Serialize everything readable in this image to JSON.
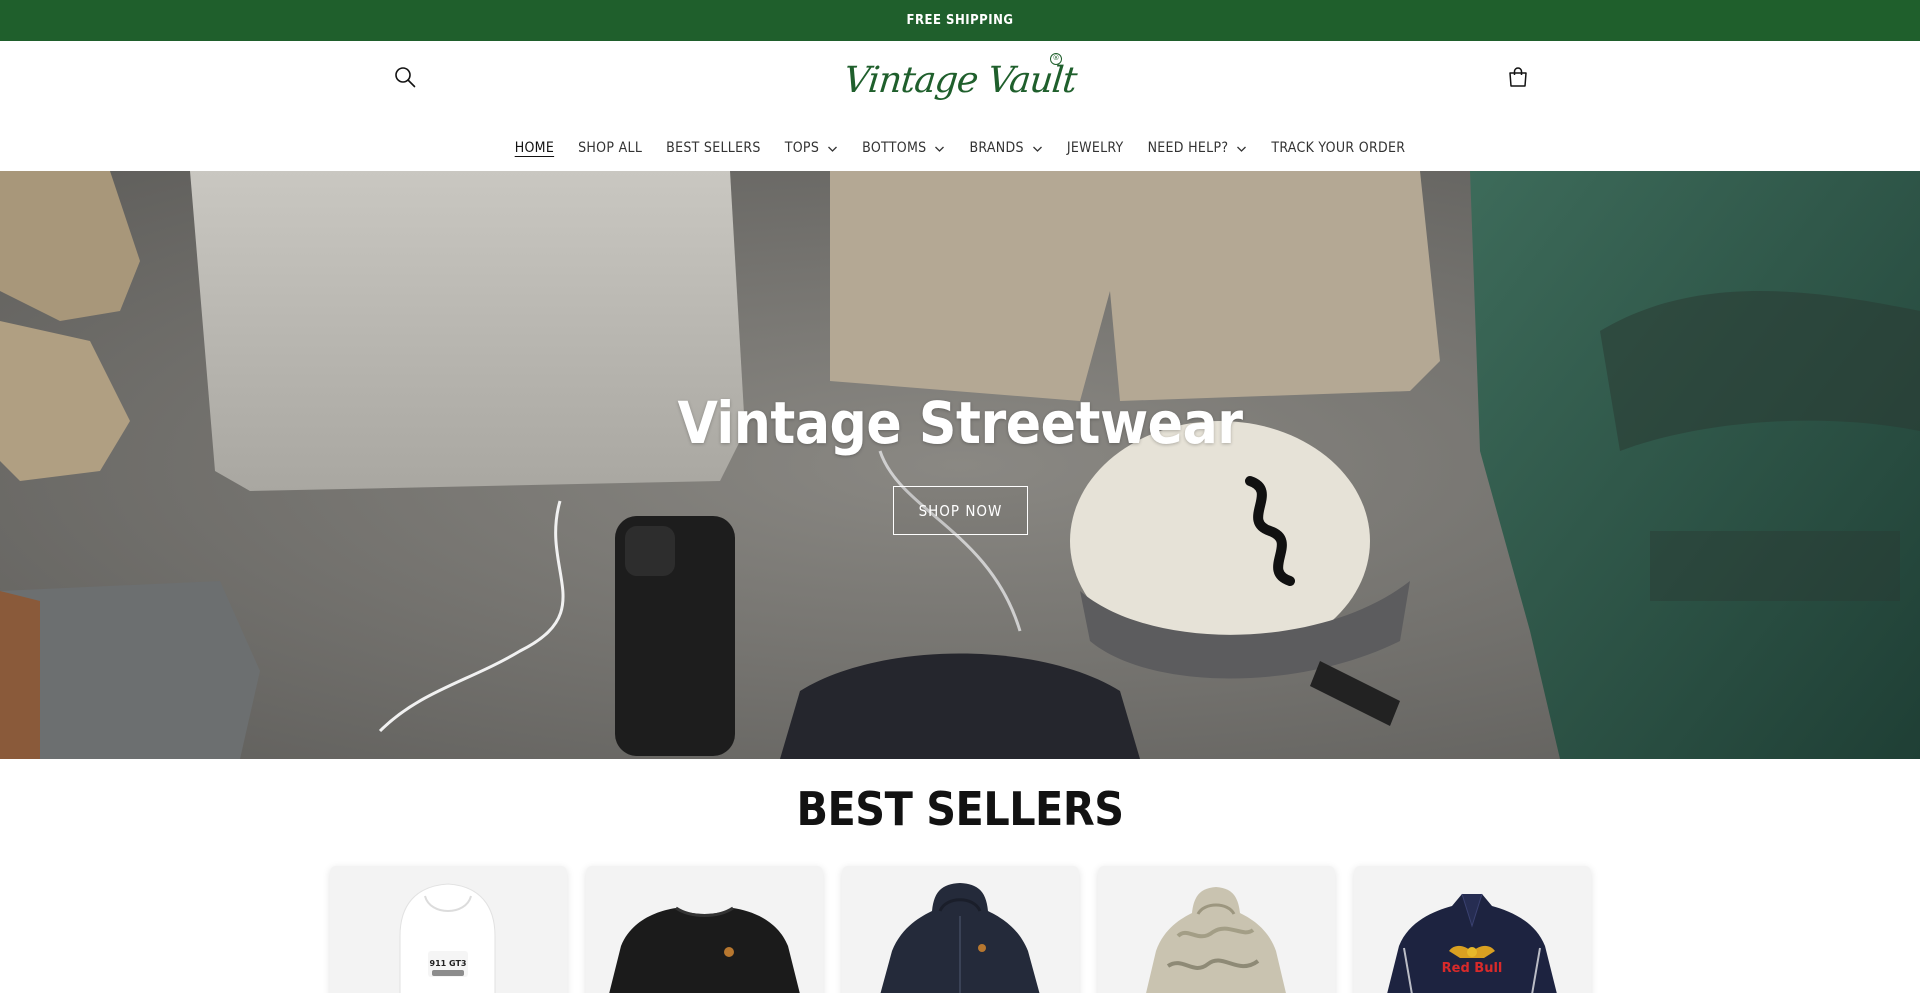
{
  "announcement": {
    "text": "FREE SHIPPING"
  },
  "header": {
    "logo_text": "Vintage Vault",
    "logo_mark": "®",
    "search_icon": "search-icon",
    "cart_icon": "cart-icon"
  },
  "nav": {
    "items": [
      {
        "label": "HOME",
        "active": true,
        "dropdown": false
      },
      {
        "label": "SHOP ALL",
        "dropdown": false
      },
      {
        "label": "BEST SELLERS",
        "dropdown": false
      },
      {
        "label": "TOPS",
        "dropdown": true
      },
      {
        "label": "BOTTOMS",
        "dropdown": true
      },
      {
        "label": "BRANDS",
        "dropdown": true
      },
      {
        "label": "JEWELRY",
        "dropdown": false
      },
      {
        "label": "NEED HELP?",
        "dropdown": true
      },
      {
        "label": "TRACK YOUR ORDER",
        "dropdown": false
      }
    ]
  },
  "hero": {
    "title": "Vintage Streetwear",
    "button_label": "SHOP NOW"
  },
  "best_sellers": {
    "title": "BEST SELLERS",
    "products": [
      {
        "image": "white hoodie with 911 GT3 graphic",
        "graphic_text": "911 GT3"
      },
      {
        "image": "black crewneck sweatshirt"
      },
      {
        "image": "navy zip hoodie"
      },
      {
        "image": "camo hoodie"
      },
      {
        "image": "navy racing jacket",
        "graphic_text": "Red Bull"
      }
    ]
  },
  "colors": {
    "brand_green": "#1f5f2c",
    "text": "#121212",
    "card_bg": "#f3f3f3"
  }
}
